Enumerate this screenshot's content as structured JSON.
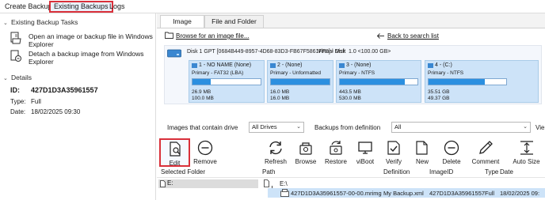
{
  "top_tabs": [
    {
      "label": "Create Backups",
      "active": false
    },
    {
      "label": "Existing Backups",
      "active": true
    },
    {
      "label": "Logs",
      "active": false
    }
  ],
  "left": {
    "tasks_header": "Existing Backup Tasks",
    "tasks": [
      {
        "label": "Open an image or backup file in Windows Explorer",
        "icon": "folder-open-icon"
      },
      {
        "label": "Detach a backup image from Windows Explorer",
        "icon": "detach-icon"
      }
    ],
    "details_header": "Details",
    "details": {
      "id_label": "ID:",
      "id_value": "427D1D3A35961557",
      "type_label": "Type:",
      "type_value": "Full",
      "date_label": "Date:",
      "date_value": "18/02/2025 09:30"
    }
  },
  "right_tabs": [
    {
      "label": "Image",
      "selected": true
    },
    {
      "label": "File and Folder",
      "selected": false
    }
  ],
  "image_panel": {
    "browse_link": "Browse for an image file...",
    "back_link": "Back to search list",
    "disk_title": "Disk 1 GPT [0684B449-8957-4D68-83D3-FB67F5861FF8] - Msft",
    "virtual_disk": "Virtual Disk",
    "disk_size": "1.0   <100.00 GB>",
    "partitions": [
      {
        "title": "1 - NO NAME (None)",
        "type": "Primary - FAT32 (LBA)",
        "used": "26.9 MB",
        "total": "100.0 MB",
        "fill": 0.27
      },
      {
        "title": "2 -  (None)",
        "type": "Primary - Unformatted",
        "used": "16.0 MB",
        "total": "16.0 MB",
        "fill": 1.0
      },
      {
        "title": "3 -  (None)",
        "type": "Primary - NTFS",
        "used": "443.5 MB",
        "total": "530.0 MB",
        "fill": 0.84
      },
      {
        "title": "4 - (C:)",
        "type": "Primary - NTFS",
        "used": "35.51 GB",
        "total": "49.37 GB",
        "fill": 0.72
      }
    ]
  },
  "filters": {
    "drive_label": "Images that contain drive",
    "drive_value": "All Drives",
    "definition_label": "Backups from definition",
    "definition_value": "All",
    "view_label": "Vie"
  },
  "toolbar": [
    {
      "label": "Edit",
      "icon": "edit-icon",
      "highlighted": true
    },
    {
      "label": "Remove",
      "icon": "remove-icon"
    },
    {
      "label": "Refresh",
      "icon": "refresh-icon"
    },
    {
      "label": "Browse",
      "icon": "browse-icon"
    },
    {
      "label": "Restore",
      "icon": "restore-icon"
    },
    {
      "label": "viBoot",
      "icon": "viboot-icon"
    },
    {
      "label": "Verify",
      "icon": "verify-icon"
    },
    {
      "label": "New",
      "icon": "new-icon"
    },
    {
      "label": "Delete",
      "icon": "delete-icon"
    },
    {
      "label": "Comment",
      "icon": "comment-icon"
    },
    {
      "label": "Auto Size",
      "icon": "autosize-icon"
    }
  ],
  "list": {
    "headers": {
      "selected_folder": "Selected Folder",
      "path": "Path",
      "definition": "Definition",
      "image_id": "ImageID",
      "type": "Type",
      "date": "Date"
    },
    "folders": [
      "E:"
    ],
    "path_parent": "E:\\",
    "rows": [
      {
        "path": "427D1D3A35961557-00-00.mrimg",
        "definition": "My Backup.xml",
        "image_id": "427D1D3A35961557",
        "type": "Full",
        "date": "18/02/2025 09:"
      }
    ]
  },
  "colors": {
    "accent_red": "#d9303a",
    "partition_bg": "#cde3f8",
    "usage_fill": "#2b8fe0",
    "selection": "#cde3f8"
  }
}
